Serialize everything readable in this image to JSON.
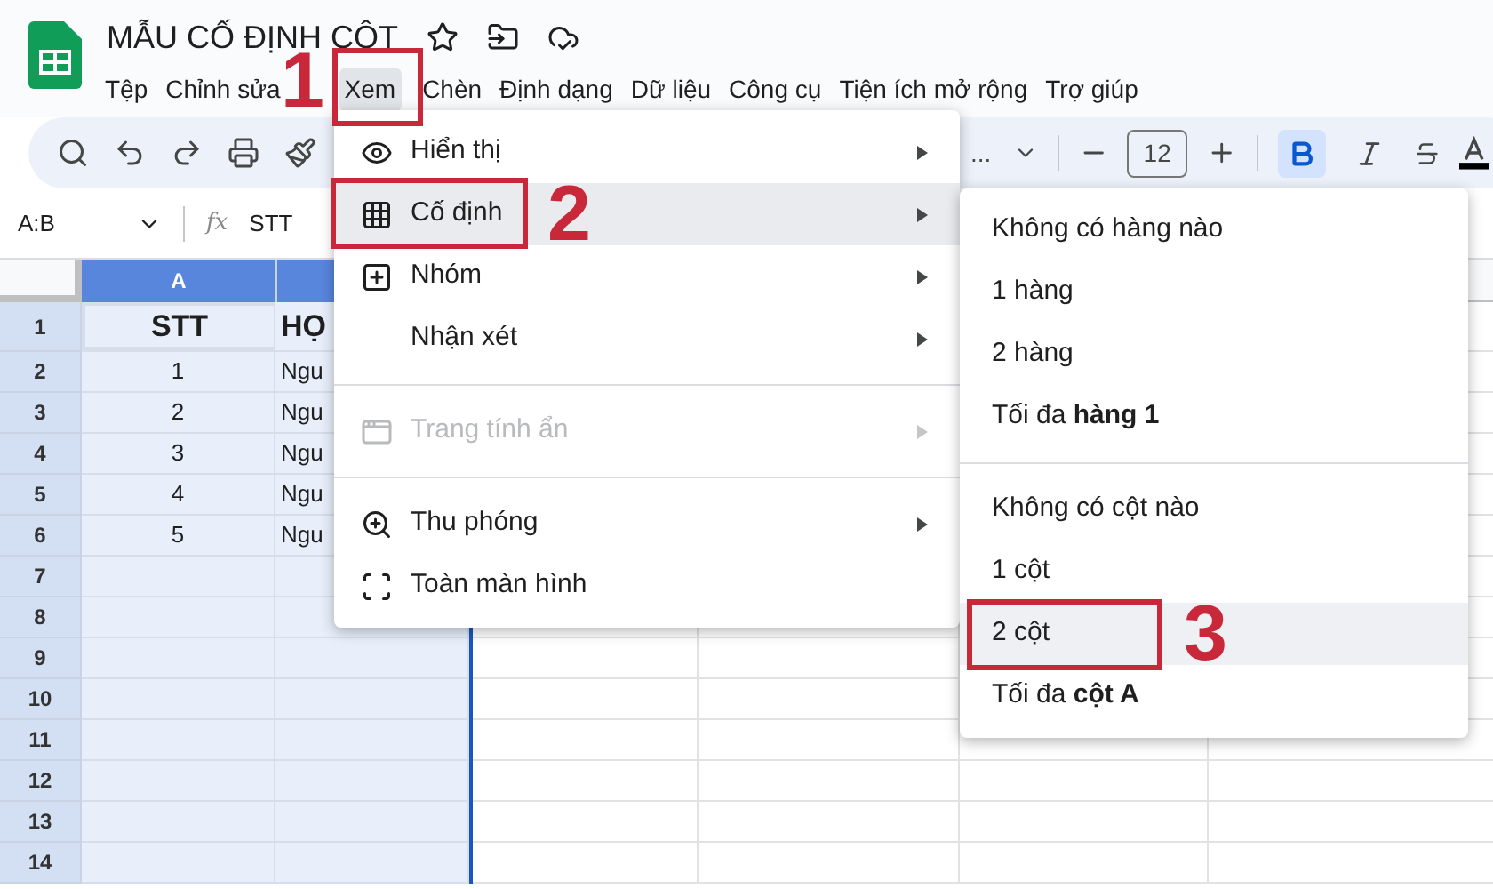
{
  "doc": {
    "title": "MẪU CỐ ĐỊNH CỘT"
  },
  "menubar": [
    {
      "label": "Tệp",
      "selected": false
    },
    {
      "label": "Chỉnh sửa",
      "selected": false
    },
    {
      "label": "Xem",
      "selected": true
    },
    {
      "label": "Chèn",
      "selected": false
    },
    {
      "label": "Định dạng",
      "selected": false
    },
    {
      "label": "Dữ liệu",
      "selected": false
    },
    {
      "label": "Công cụ",
      "selected": false
    },
    {
      "label": "Tiện ích mở rộng",
      "selected": false
    },
    {
      "label": "Trợ giúp",
      "selected": false
    }
  ],
  "toolbar": {
    "font": "...",
    "font_size": "12",
    "bold": true,
    "italic": false
  },
  "formula_bar": {
    "range": "A:B",
    "fx": "fx",
    "formula": "STT"
  },
  "sheet": {
    "columns": [
      {
        "label": "A",
        "selected": true
      }
    ],
    "rows": [
      {
        "label": "1",
        "cells": [
          "STT",
          "HỌ"
        ]
      },
      {
        "label": "2",
        "cells": [
          "1",
          "Ngu"
        ]
      },
      {
        "label": "3",
        "cells": [
          "2",
          "Ngu"
        ]
      },
      {
        "label": "4",
        "cells": [
          "3",
          "Ngu"
        ]
      },
      {
        "label": "5",
        "cells": [
          "4",
          "Ngu"
        ]
      },
      {
        "label": "6",
        "cells": [
          "5",
          "Ngu"
        ]
      },
      {
        "label": "7",
        "cells": []
      },
      {
        "label": "8",
        "cells": []
      },
      {
        "label": "9",
        "cells": []
      },
      {
        "label": "10",
        "cells": []
      },
      {
        "label": "11",
        "cells": []
      },
      {
        "label": "12",
        "cells": []
      },
      {
        "label": "13",
        "cells": []
      },
      {
        "label": "14",
        "cells": []
      }
    ]
  },
  "view_menu": [
    {
      "kind": "item",
      "label": "Hiển thị",
      "submenu": true,
      "disabled": false,
      "selected": false
    },
    {
      "kind": "item",
      "label": "Cố định",
      "submenu": true,
      "disabled": false,
      "selected": true
    },
    {
      "kind": "item",
      "label": "Nhóm",
      "submenu": true,
      "disabled": false,
      "selected": false
    },
    {
      "kind": "item",
      "label": "Nhận xét",
      "submenu": true,
      "disabled": false,
      "selected": false
    },
    {
      "kind": "divider"
    },
    {
      "kind": "item",
      "label": "Trang tính ẩn",
      "submenu": true,
      "disabled": true,
      "selected": false
    },
    {
      "kind": "divider"
    },
    {
      "kind": "item",
      "label": "Thu phóng",
      "submenu": true,
      "disabled": false,
      "selected": false
    },
    {
      "kind": "item",
      "label": "Toàn màn hình",
      "submenu": false,
      "disabled": false,
      "selected": false
    }
  ],
  "freeze_menu": [
    {
      "kind": "item",
      "label": "Không có hàng nào",
      "selected": false
    },
    {
      "kind": "item",
      "label": "1 hàng",
      "selected": false
    },
    {
      "kind": "item",
      "label": "2 hàng",
      "selected": false
    },
    {
      "kind": "item",
      "label": "Tối đa **hàng 1**",
      "selected": false
    },
    {
      "kind": "divider"
    },
    {
      "kind": "item",
      "label": "Không có cột nào",
      "selected": false
    },
    {
      "kind": "item",
      "label": "1 cột",
      "selected": false
    },
    {
      "kind": "item",
      "label": "2 cột",
      "selected": true
    },
    {
      "kind": "item",
      "label": "Tối đa **cột A**",
      "selected": false
    }
  ],
  "callouts": [
    {
      "number": "1"
    },
    {
      "number": "2"
    },
    {
      "number": "3"
    }
  ]
}
